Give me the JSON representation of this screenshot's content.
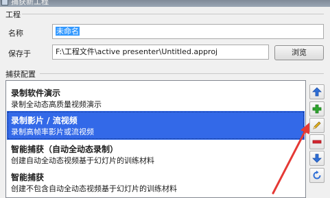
{
  "window": {
    "title": "捕获新工程"
  },
  "project": {
    "group_label": "工程",
    "name_label": "名称",
    "name_value": "未命名",
    "save_label": "保存于",
    "save_path": "F:\\工程文件\\active presenter\\Untitled.approj",
    "browse_label": "浏览"
  },
  "capture": {
    "group_label": "捕获配置",
    "profiles": [
      {
        "title": "录制软件演示",
        "desc": "录制全动态高质量视频演示",
        "selected": false
      },
      {
        "title": "录制影片 / 流视频",
        "desc": "录制高帧率影片或流视频",
        "selected": true
      },
      {
        "title": "智能捕获（自动全动态录制）",
        "desc": "创建自动全动态视频基于幻灯片的训练材料",
        "selected": false
      },
      {
        "title": "智能捕获",
        "desc": "创建不包含自动全动态视频基于幻灯片的训练材料",
        "selected": false
      }
    ],
    "side_buttons": [
      {
        "icon": "move-up-icon",
        "color": "#2f6fd6"
      },
      {
        "icon": "add-icon",
        "color": "#2fa52f"
      },
      {
        "icon": "edit-pencil-icon",
        "color": "#e6b422"
      },
      {
        "icon": "remove-icon",
        "color": "#d6262f"
      },
      {
        "icon": "move-down-icon",
        "color": "#2f6fd6"
      },
      {
        "icon": "reset-icon",
        "color": "#2f6fd6"
      }
    ]
  },
  "annotation": {
    "arrow_color": "#e53935"
  }
}
